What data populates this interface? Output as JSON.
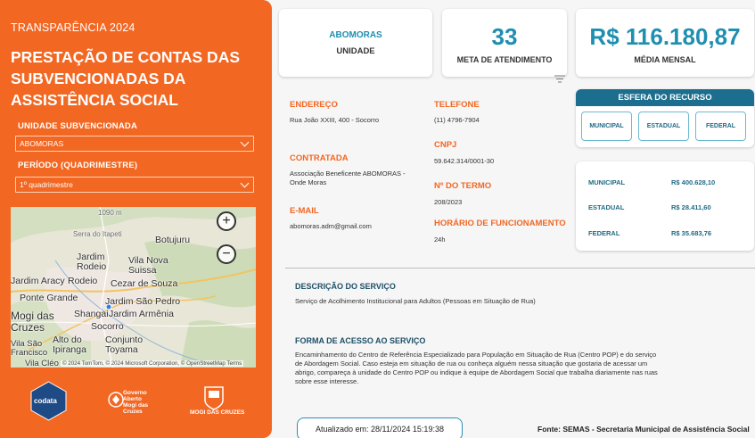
{
  "left_panel": {
    "kicker": "TRANSPARÊNCIA 2024",
    "title": "PRESTAÇÃO DE CONTAS DAS SUBVENCIONADAS DA ASSISTÊNCIA SOCIAL",
    "unidade_label": "UNIDADE SUBVENCIONADA",
    "unidade_value": "ABOMORAS",
    "periodo_label": "PERÍODO (QUADRIMESTRE)",
    "periodo_value": "1º quadrimestre"
  },
  "map": {
    "labels": [
      "Serra do Itapeti",
      "1090 m",
      "Botujuru",
      "Jardim Rodeio",
      "Vila Nova Suissa",
      "Jardim Aracy",
      "Rodeio",
      "Cezar de Souza",
      "Ponte Grande",
      "Jardim São Pedro",
      "Mogi das Cruzes",
      "Shangai",
      "Jardim Armênia",
      "Socorro",
      "Vila São Francisco",
      "Alto do Ipiranga",
      "Conjunto Toyama",
      "Vila Cléo"
    ],
    "attribution": "© 2024 TomTom, © 2024 Microsoft Corporation, © OpenStreetMap Terms",
    "zoom_in": "+",
    "zoom_out": "−"
  },
  "logos": {
    "codata": "codata",
    "gam": [
      "Governo",
      "Aberto",
      "Mogi das",
      "Cruzes"
    ],
    "mc": "MOGI DAS CRUZES"
  },
  "kpis": {
    "unidade_value": "ABOMORAS",
    "unidade_label": "UNIDADE",
    "meta_value": "33",
    "meta_label": "META DE ATENDIMENTO",
    "media_value": "R$ 116.180,87",
    "media_label": "MÉDIA MENSAL"
  },
  "info": {
    "endereco_label": "ENDEREÇO",
    "endereco_value": "Rua João XXIII, 400 - Socorro",
    "telefone_label": "TELEFONE",
    "telefone_value": "(11) 4796-7904",
    "cnpj_label": "CNPJ",
    "cnpj_value": "59.642.314/0001-30",
    "contratada_label": "CONTRATADA",
    "contratada_value": "Associação Beneficente ABOMORAS - Onde Moras",
    "termo_label": "Nº DO TERMO",
    "termo_value": "208/2023",
    "email_label": "E-MAIL",
    "email_value": "abomoras.adm@gmail.com",
    "horario_label": "HORÁRIO DE FUNCIONAMENTO",
    "horario_value": "24h"
  },
  "esfera": {
    "title": "ESFERA DO RECURSO",
    "buttons": [
      "MUNICIPAL",
      "ESTADUAL",
      "FEDERAL"
    ]
  },
  "totals": [
    {
      "label": "MUNICIPAL",
      "value": "R$ 400.628,10"
    },
    {
      "label": "ESTADUAL",
      "value": "R$ 28.411,60"
    },
    {
      "label": "FEDERAL",
      "value": "R$ 35.683,76"
    }
  ],
  "servico": {
    "title": "DESCRIÇÃO DO SERVIÇO",
    "text": "Serviço de Acolhimento Institucional para Adultos (Pessoas em Situação de Rua)"
  },
  "acesso": {
    "title": "FORMA DE ACESSO AO SERVIÇO",
    "text": "Encaminhamento do Centro de Referência Especializado para População em Situação de Rua (Centro POP) e do serviço de Abordagem Social. Caso esteja em situação de rua ou conheça alguém nessa situação que gostaria de acessar um abrigo, compareça à unidade do Centro POP ou indique à equipe de Abordagem Social que trabalha diariamente nas ruas sobre esse interesse."
  },
  "footer": {
    "updated": "Atualizado em: 28/11/2024 15:19:38",
    "source": "Fonte: SEMAS - Secretaria Municipal de Assistência Social"
  },
  "colors": {
    "brand_orange": "#f26722",
    "accent_blue": "#1f8fb0",
    "header_blue": "#1c6e8f"
  }
}
